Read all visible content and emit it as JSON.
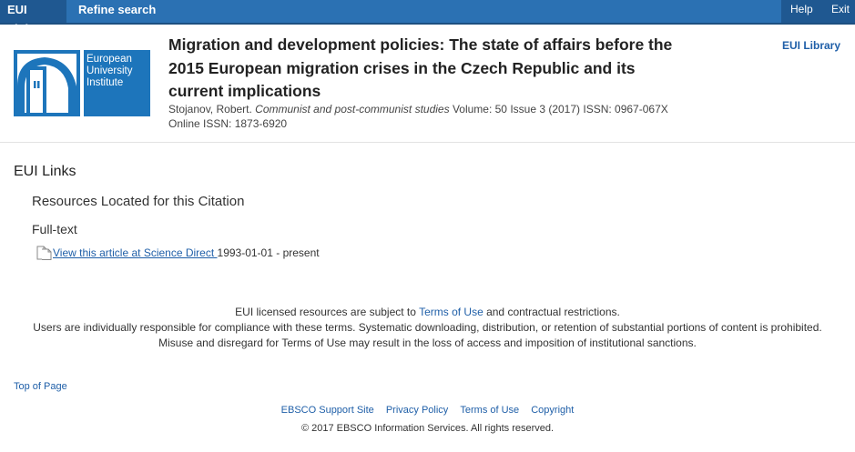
{
  "nav": {
    "eui_links": "EUI Links",
    "refine_search": "Refine search",
    "help": "Help",
    "exit": "Exit"
  },
  "header": {
    "logo_text_lines": [
      "European",
      "University",
      "Institute"
    ],
    "title": "Migration and development policies: The state of affairs before the 2015 European migration crises in the Czech Republic and its current implications",
    "author": "Stojanov, Robert.",
    "journal": "Communist and post-communist studies",
    "details": "Volume: 50 Issue 3 (2017) ISSN: 0967-067X",
    "online_issn": "Online ISSN: 1873-6920",
    "library_link": "EUI Library"
  },
  "content": {
    "heading": "EUI Links",
    "subheading": "Resources Located for this Citation",
    "section": "Full-text",
    "result_link": "View this article at Science Direct ",
    "result_range": "1993-01-01 - present"
  },
  "notice": {
    "line1_before": "EUI licensed resources are subject to ",
    "line1_link": "Terms of Use",
    "line1_after": " and contractual restrictions.",
    "line2": "Users are individually responsible for compliance with these terms. Systematic downloading, distribution, or retention of substantial portions of content is prohibited.",
    "line3": "Misuse and disregard for Terms of Use may result in the loss of access and imposition of institutional sanctions."
  },
  "footer": {
    "top_of_page": "Top of Page",
    "links": [
      "EBSCO Support Site",
      "Privacy Policy",
      "Terms of Use",
      "Copyright"
    ],
    "copyright": "© 2017 EBSCO Information Services. All rights reserved."
  },
  "colors": {
    "nav_bar": "#2b71b3",
    "nav_active": "#1f5891",
    "link": "#1f5fa8",
    "logo_blue": "#1d75bb"
  }
}
